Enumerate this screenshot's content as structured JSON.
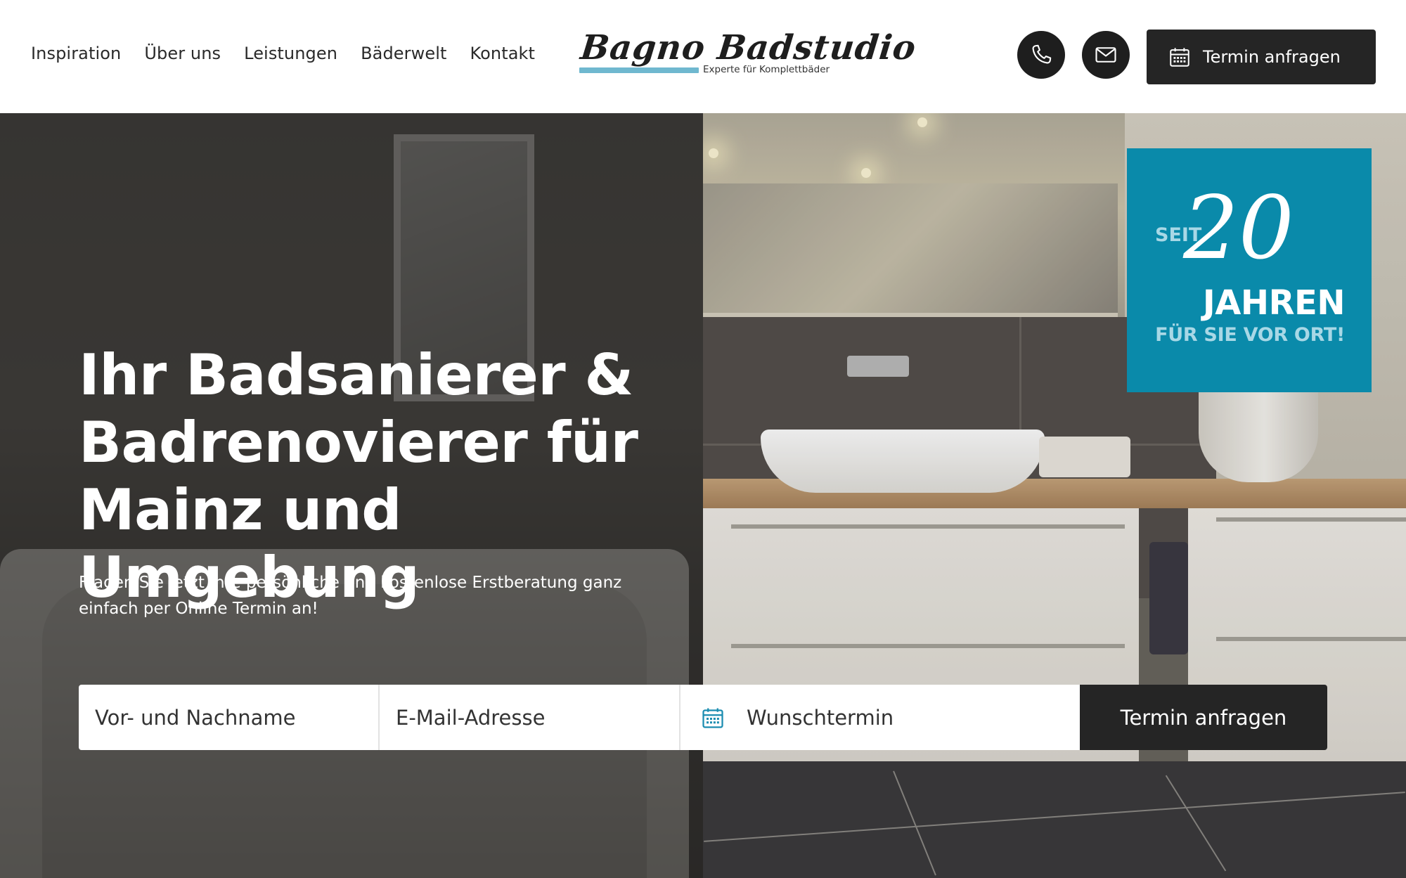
{
  "nav": {
    "items": [
      {
        "label": "Inspiration"
      },
      {
        "label": "Über uns"
      },
      {
        "label": "Leistungen"
      },
      {
        "label": "Bäderwelt"
      },
      {
        "label": "Kontakt"
      }
    ]
  },
  "logo": {
    "name": "Bagno Badstudio",
    "tagline": "Experte für Komplettbäder",
    "accent_color": "#6fb8cf"
  },
  "header_actions": {
    "phone_icon": "phone-icon",
    "mail_icon": "mail-icon",
    "cta_icon": "calendar-icon",
    "cta_label": "Termin anfragen"
  },
  "hero": {
    "title_lines": [
      "Ihr Badsanierer &",
      "Badrenovierer für",
      "Mainz und Umgebung"
    ],
    "subtitle": "Fragen Sie jetzt Ihre persönliche und kostenlose Erstberatung ganz einfach per Online Termin an!"
  },
  "booking_form": {
    "name_placeholder": "Vor- und Nachname",
    "email_placeholder": "E-Mail-Adresse",
    "date_placeholder": "Wunschtermin",
    "date_icon": "calendar-icon",
    "submit_label": "Termin anfragen"
  },
  "badge": {
    "prefix": "SEIT",
    "number": "20",
    "line1": "JAHREN",
    "line2": "FÜR SIE VOR ORT!",
    "color": "#0a8aaa"
  },
  "colors": {
    "dark": "#252525",
    "accent_blue": "#0a8aaa",
    "calendar_blue": "#1a8cb0"
  }
}
